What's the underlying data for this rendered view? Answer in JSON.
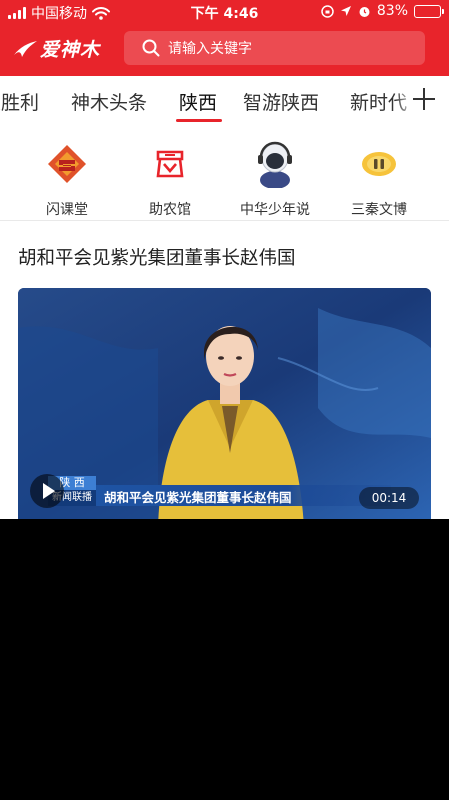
{
  "status_bar": {
    "carrier": "中国移动",
    "time": "下午 4:46",
    "battery_percent": "83%",
    "battery_level": 0.83,
    "icons": [
      "signal-icon",
      "wifi-icon",
      "lock-rotation-icon",
      "location-icon",
      "alarm-icon",
      "battery-icon"
    ]
  },
  "header": {
    "app_logo": "爱神木",
    "search_placeholder": "请输入关键字"
  },
  "tabs": {
    "items": [
      {
        "label": "双胜利"
      },
      {
        "label": "神木头条"
      },
      {
        "label": "陕西",
        "active": true
      },
      {
        "label": "智游陕西"
      },
      {
        "label": "新时代"
      }
    ],
    "add_icon": "plus-icon"
  },
  "quick_entries": [
    {
      "label": "闪课堂",
      "icon": "shanketang-icon"
    },
    {
      "label": "助农馆",
      "icon": "zhunongguan-icon"
    },
    {
      "label": "中华少年说",
      "icon": "headset-boy-icon"
    },
    {
      "label": "三秦文博",
      "icon": "pause-coin-icon"
    }
  ],
  "article": {
    "title": "胡和平会见紫光集团董事长赵伟国",
    "video": {
      "channel_logo_top": "陕 西",
      "channel_logo_bottom": "新闻联播",
      "caption": "胡和平会见紫光集团董事长赵伟国",
      "duration": "00:14"
    }
  },
  "colors": {
    "brand_red": "#e8242b",
    "tab_text": "#333333",
    "divider": "#e9e9e9",
    "video_bg": "#1c3a74",
    "anchor_jacket": "#e6bf3a"
  }
}
